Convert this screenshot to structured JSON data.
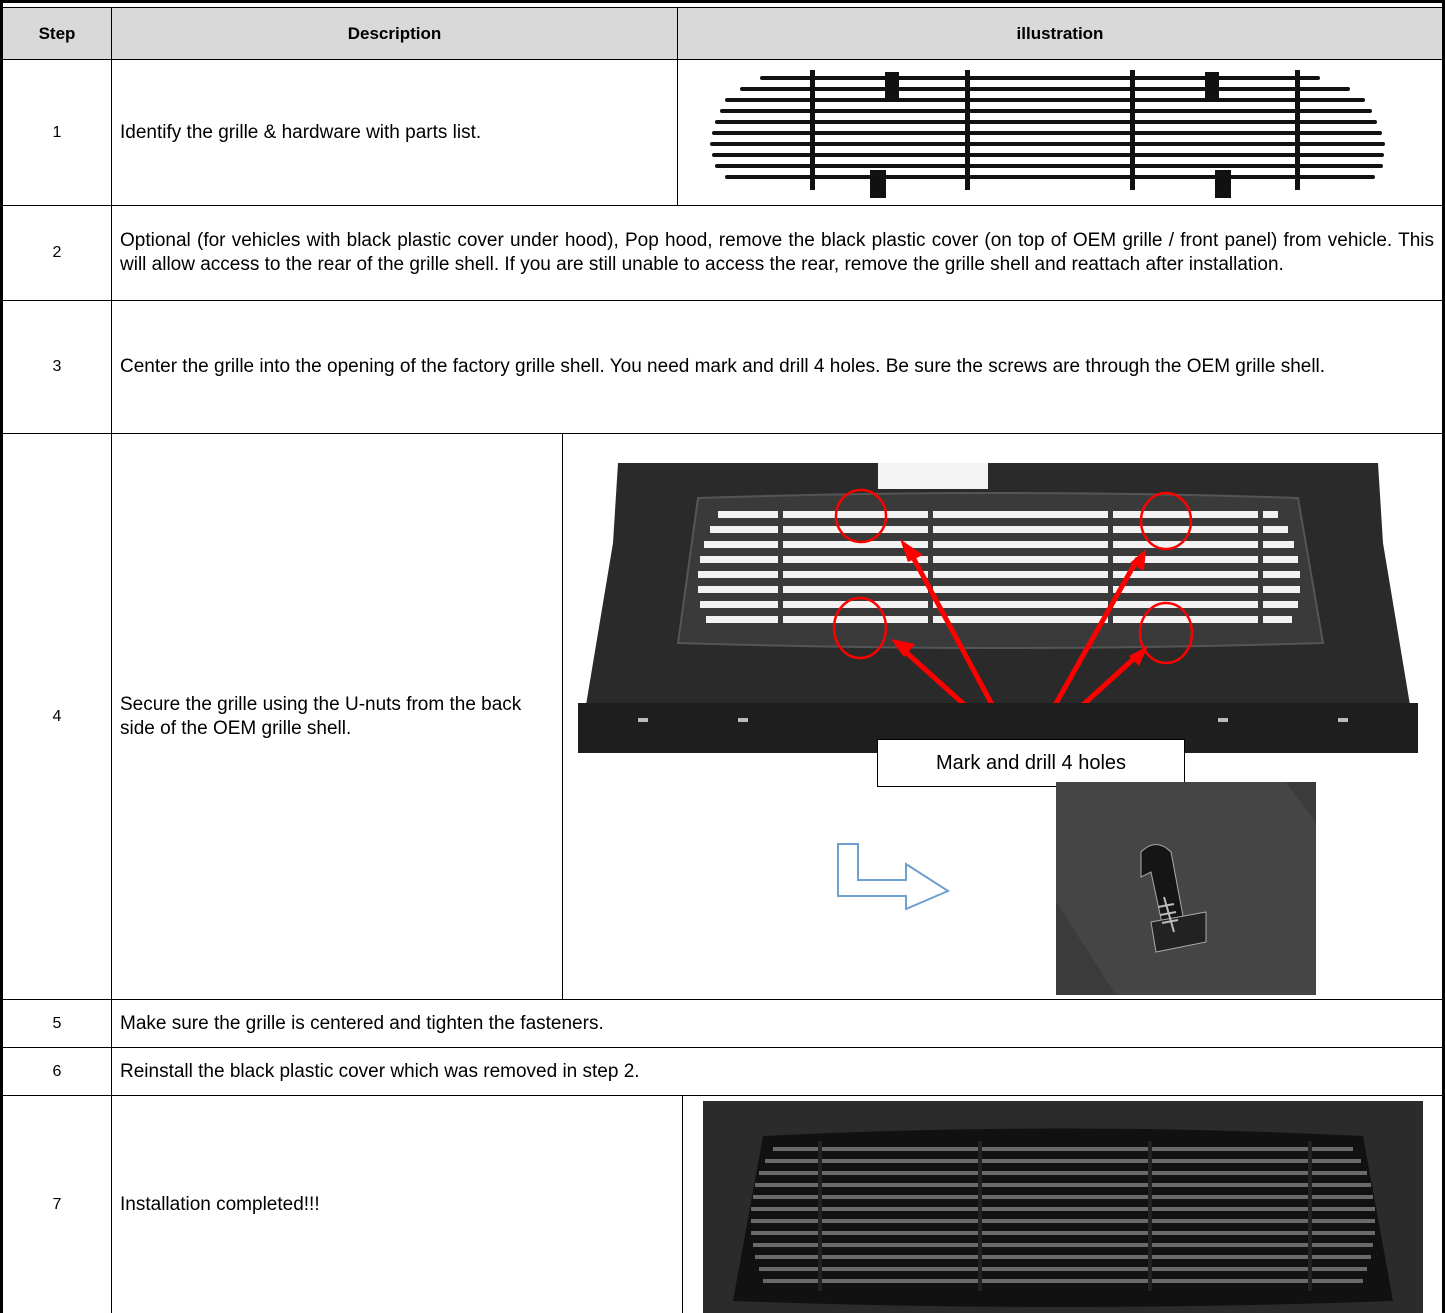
{
  "header": {
    "step": "Step",
    "description": "Description",
    "illustration": "illustration"
  },
  "steps": [
    {
      "number": "1",
      "text": "Identify the grille & hardware with parts list."
    },
    {
      "number": "2",
      "text": "Optional (for vehicles with black plastic cover under hood), Pop hood, remove the black plastic cover (on top of OEM grille / front panel) from vehicle. This will allow access to the rear of the grille shell. If you are still unable to access the rear, remove the grille shell and reattach after installation."
    },
    {
      "number": "3",
      "text": "Center the grille into the opening of the factory grille shell.  You need mark and drill 4 holes. Be sure the screws are through the OEM grille shell."
    },
    {
      "number": "4",
      "text": "Secure the grille using the U-nuts from the back side of the OEM grille shell."
    },
    {
      "number": "5",
      "text": "Make sure the grille is centered and tighten the fasteners."
    },
    {
      "number": "6",
      "text": "Reinstall the black plastic cover which was removed in step 2."
    },
    {
      "number": "7",
      "text": "Installation completed!!!"
    }
  ],
  "callout": "Mark and drill 4 holes",
  "colors": {
    "header_bg": "#d9d9d9",
    "marker_red": "#ff0000",
    "arrow_blue": "#6f9fcf"
  }
}
